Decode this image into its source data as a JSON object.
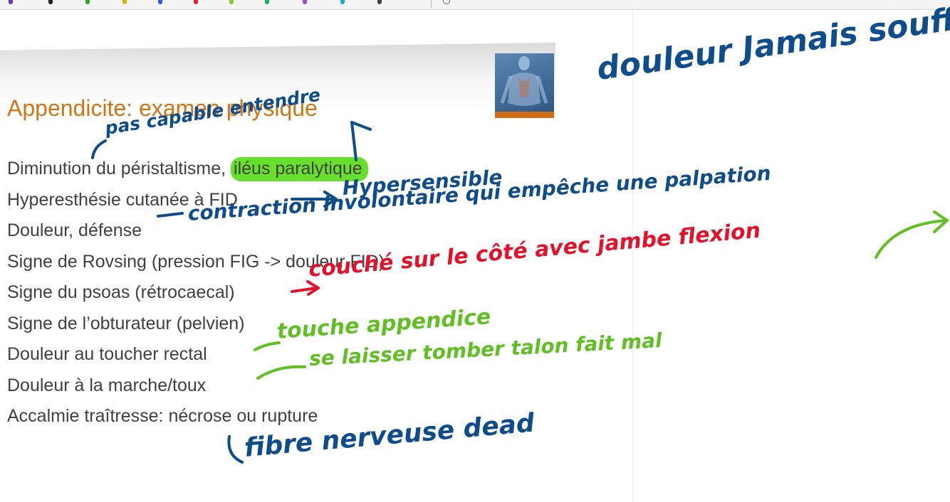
{
  "slide": {
    "title": "Appendicite: examen physique",
    "bullets": [
      {
        "before": "Diminution du péristaltisme,",
        "highlight": "iléus paralytique"
      },
      {
        "before": "Hyperesthésie cutanée à FID",
        "highlight": ""
      },
      {
        "before": "Douleur, défense",
        "highlight": ""
      },
      {
        "before": "Signe de Rovsing (pression FIG -> douleur FID)",
        "highlight": ""
      },
      {
        "before": "Signe du psoas (rétrocaecal)",
        "highlight": ""
      },
      {
        "before": "Signe de l’obturateur (pelvien)",
        "highlight": ""
      },
      {
        "before": "Douleur au toucher rectal",
        "highlight": ""
      },
      {
        "before": "Douleur à la marche/toux",
        "highlight": ""
      },
      {
        "before": "Accalmie traîtresse: nécrose ou rupture",
        "highlight": ""
      }
    ]
  },
  "annotations": {
    "top_right": "douleur Jamais souff",
    "pas_capable": "pas capable entendre",
    "hypersensible": "Hypersensible",
    "contraction": "contraction involontaire qui empêche une palpation",
    "couche": "couché sur le côté avec jambe flexion",
    "touche": "touche appendice",
    "laisser": "se laisser tomber talon fait mal",
    "fibre": "fibre nerveuse dead"
  },
  "colors": {
    "title": "#d27416",
    "highlight": "#66e02a",
    "ink_blue": "#0e4c8c",
    "ink_red": "#e3122a",
    "ink_green": "#5fbf23"
  },
  "toolbar": {
    "pen_colors": [
      "#7a2fb0",
      "#222222",
      "#22aa22",
      "#d4b800",
      "#3355dd",
      "#dd2222",
      "#88cc22",
      "#22aa66",
      "#aa44cc",
      "#22aacc"
    ]
  }
}
